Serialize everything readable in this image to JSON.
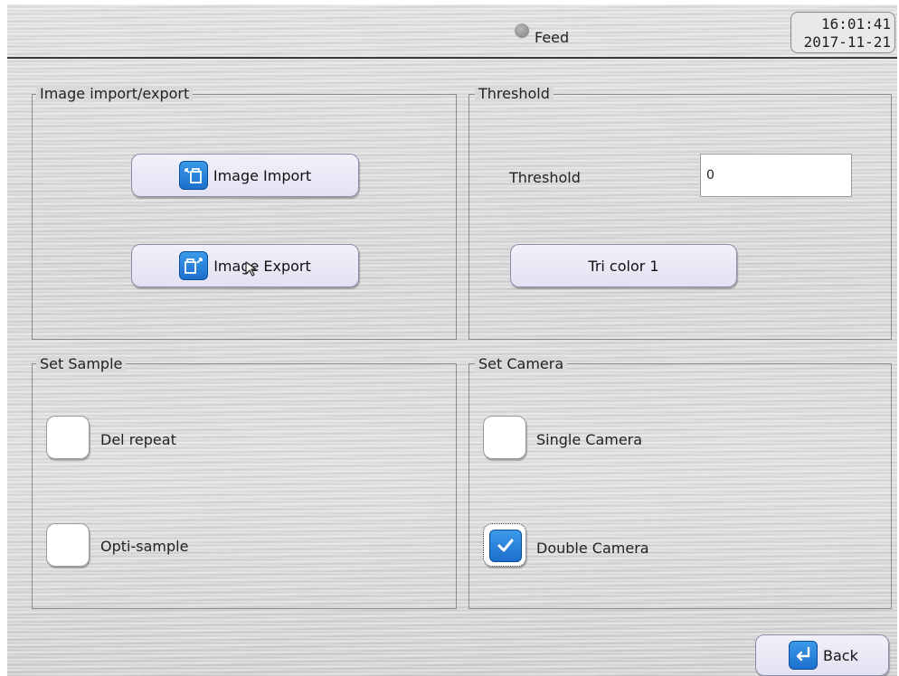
{
  "header": {
    "status_label": "Feed",
    "time": "16:01:41",
    "date": "2017-11-21"
  },
  "image_group": {
    "title": "Image import/export",
    "import_label": "Image Import",
    "export_label": "Image Export"
  },
  "threshold_group": {
    "title": "Threshold",
    "threshold_label": "Threshold",
    "threshold_value": "0",
    "tri_color_label": "Tri color 1"
  },
  "sample_group": {
    "title": "Set Sample",
    "del_repeat_label": "Del repeat",
    "del_repeat_checked": false,
    "opti_sample_label": "Opti-sample",
    "opti_sample_checked": false
  },
  "camera_group": {
    "title": "Set Camera",
    "single_camera_label": "Single Camera",
    "single_camera_checked": false,
    "double_camera_label": "Double Camera",
    "double_camera_checked": true
  },
  "footer": {
    "back_label": "Back"
  },
  "icons": {
    "import": "image-import-icon",
    "export": "image-export-icon",
    "back": "back-arrow-icon",
    "check": "checkmark-icon",
    "status": "status-dot-icon"
  },
  "colors": {
    "accent_blue": "#1d6fcc",
    "status_gray": "#8a8a8a",
    "button_face": "#e6e6f4"
  }
}
